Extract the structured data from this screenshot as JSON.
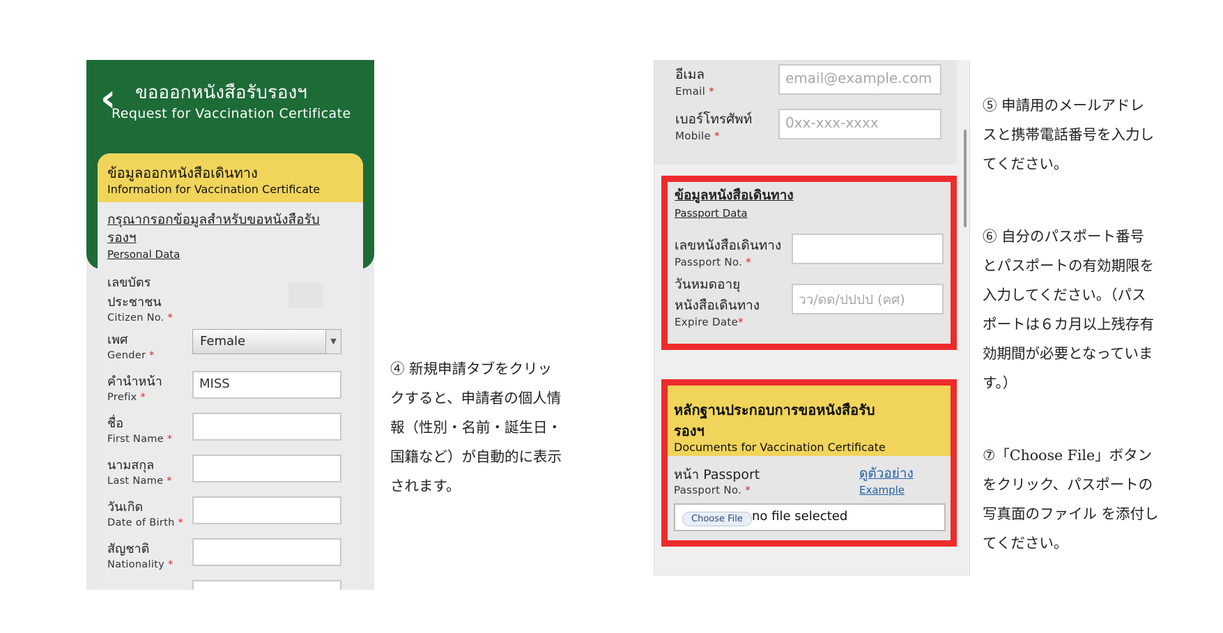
{
  "left": {
    "back_icon": "chevron-left-icon",
    "title_th": "ขอออกหนังสือรับรองฯ",
    "title_en": "Request for Vaccination Certificate",
    "card_title_th": "ข้อมูลออกหนังสือเดินทาง",
    "card_title_en": "Information for Vaccination Certificate",
    "section_th_1": "กรุณากรอกข้อมูลสำหรับขอหนังสือรับ",
    "section_th_2": "รองฯ",
    "section_en": "Personal Data",
    "fields": [
      {
        "th": "เลขบัตร",
        "th2": "ประชาชน",
        "en": "Citizen No."
      },
      {
        "th": "เพศ",
        "en": "Gender",
        "value": "Female"
      },
      {
        "th": "คำนำหน้า",
        "en": "Prefix",
        "value": "MISS"
      },
      {
        "th": "ชื่อ",
        "en": "First Name",
        "value": ""
      },
      {
        "th": "นามสกุล",
        "en": "Last Name",
        "value": ""
      },
      {
        "th": "วันเกิด",
        "en": "Date of Birth",
        "value": ""
      },
      {
        "th": "สัญชาติ",
        "en": "Nationality",
        "value": ""
      }
    ],
    "required_mark": "*"
  },
  "right": {
    "email_th": "อีเมล",
    "email_en": "Email",
    "email_placeholder": "email@example.com",
    "mobile_th": "เบอร์โทรศัพท์",
    "mobile_en": "Mobile",
    "mobile_placeholder": "0xx-xxx-xxxx",
    "passport_section_th": "ข้อมูลหนังสือเดินทาง",
    "passport_section_en": "Passport Data",
    "passport_no_th": "เลขหนังสือเดินทาง",
    "passport_no_en": "Passport No.",
    "expire_th_1": "วันหมดอายุ",
    "expire_th_2": "หนังสือเดินทาง",
    "expire_en": "Expire Date",
    "expire_placeholder": "วว/ดด/ปปปป (คศ)",
    "docs_title_th_1": "หลักฐานประกอบการขอหนังสือรับ",
    "docs_title_th_2": "รองฯ",
    "docs_title_en": "Documents for Vaccination Certificate",
    "front_th": "หน้า Passport",
    "front_en": "Passport No.",
    "example_th": "ดูตัวอย่าง",
    "example_en": "Example",
    "choose_file": "Choose File",
    "no_file": "no file selected",
    "highlight_color": "#ee2b2b"
  },
  "notes": {
    "note4": [
      "④ 新規申請タブをクリッ",
      "クすると、申請者の個人情",
      "報（性別・名前・誕生日・",
      "国籍など）が自動的に表示",
      "されます。"
    ],
    "note5": [
      "⑤ 申請用のメールアドレ",
      "スと携帯電話番号を入力し",
      "てください。"
    ],
    "note6": [
      "⑥ 自分のパスポート番号",
      "とパスポートの有効期限を",
      "入力してください。（パス",
      "ポートは６カ月以上残存有",
      "効期間が必要となっていま",
      "す。）"
    ],
    "note7": [
      "⑦「Choose File」ボタン",
      "をクリック、パスポートの",
      "写真面のファイル を添付し",
      "てください。"
    ]
  },
  "colors": {
    "header_green": "#1d6b37",
    "card_yellow": "#f1d45a"
  }
}
